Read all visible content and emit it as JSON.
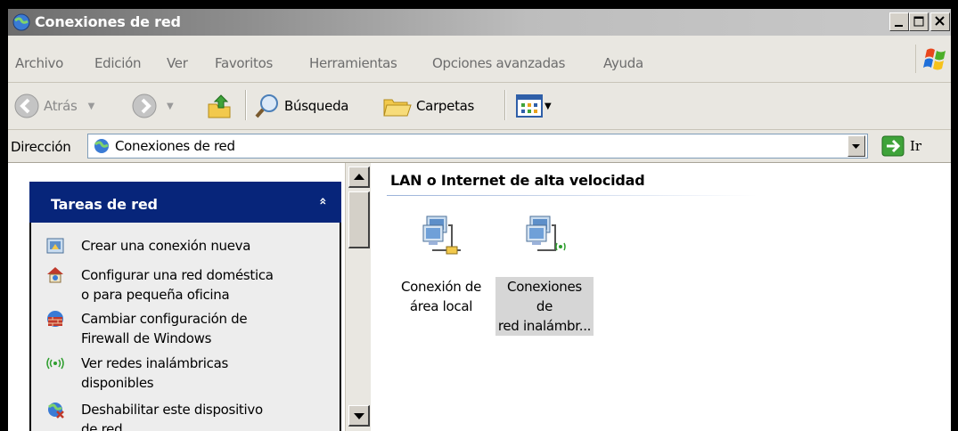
{
  "window": {
    "title": "Conexiones de red"
  },
  "menubar": {
    "items": [
      "Archivo",
      "Edición",
      "Ver",
      "Favoritos",
      "Herramientas",
      "Opciones avanzadas",
      "Ayuda"
    ]
  },
  "toolbar": {
    "back_label": "Atrás",
    "search_label": "Búsqueda",
    "folders_label": "Carpetas"
  },
  "address": {
    "label": "Dirección",
    "value": "Conexiones de red",
    "go_label": "Ir"
  },
  "task_pane": {
    "title": "Tareas de red",
    "collapse_glyph": "»",
    "tasks": [
      {
        "label_line1": "Crear una conexión nueva",
        "label_line2": "",
        "icon": "new-connection-icon"
      },
      {
        "label_line1": "Configurar una red doméstica",
        "label_line2": "o para pequeña oficina",
        "icon": "home-network-icon"
      },
      {
        "label_line1": "Cambiar configuración de",
        "label_line2": "Firewall de Windows",
        "icon": "firewall-icon"
      },
      {
        "label_line1": "Ver redes inalámbricas",
        "label_line2": "disponibles",
        "icon": "wireless-icon"
      },
      {
        "label_line1": "Deshabilitar este dispositivo",
        "label_line2": "de red",
        "icon": "disable-device-icon"
      }
    ]
  },
  "content": {
    "group_title": "LAN o Internet de alta velocidad",
    "connections": [
      {
        "line1": "Conexión de",
        "line2": "área local",
        "selected": false,
        "icon": "lan-connection-icon"
      },
      {
        "line1": "Conexiones de",
        "line2": "red inalámbr...",
        "selected": true,
        "icon": "wireless-connection-icon"
      }
    ]
  },
  "colors": {
    "panel_header": "#07257a",
    "chrome": "#e9e7e1"
  }
}
